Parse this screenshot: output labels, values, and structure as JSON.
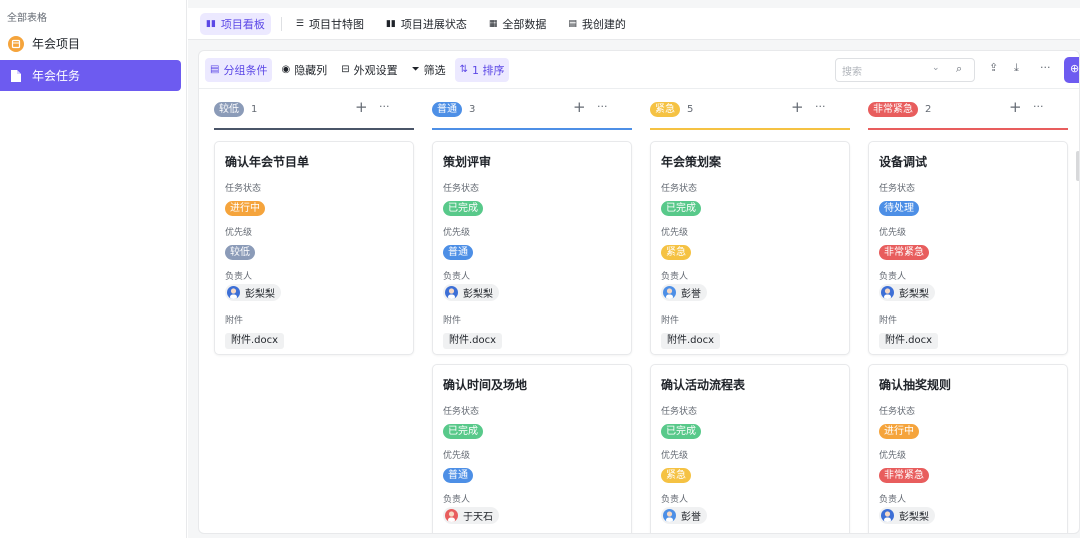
{
  "sidebar": {
    "title": "全部表格",
    "items": [
      {
        "label": "年会项目",
        "icon": "calendar-icon"
      },
      {
        "label": "年会任务",
        "icon": "document-icon"
      }
    ]
  },
  "tabs": [
    {
      "label": "项目看板",
      "icon": "kanban-icon"
    },
    {
      "label": "项目甘特图",
      "icon": "gantt-icon"
    },
    {
      "label": "项目进展状态",
      "icon": "kanban-icon"
    },
    {
      "label": "全部数据",
      "icon": "grid-icon"
    },
    {
      "label": "我创建的",
      "icon": "table-icon"
    }
  ],
  "toolbar": {
    "group_label": "分组条件",
    "hide_label": "隐藏列",
    "appearance_label": "外观设置",
    "filter_label": "筛选",
    "sort_label": "1 排序",
    "search_placeholder": "搜索"
  },
  "fields": {
    "status": "任务状态",
    "priority": "优先级",
    "owner": "负责人",
    "attachment": "附件"
  },
  "colors": {
    "accent": "#6d5bf0",
    "low": "#8b9bb8",
    "normal": "#4d8fe6",
    "urgent": "#f5c243",
    "very_urgent": "#e85d5d",
    "in_progress": "#f5a43c",
    "done": "#58c98a",
    "pending": "#4d8fe6"
  },
  "columns": [
    {
      "label": "较低",
      "count": "1",
      "cards": [
        {
          "title": "确认年会节目单",
          "status": "进行中",
          "priority": "较低",
          "owner": "彭梨梨",
          "attachment": "附件.docx"
        }
      ]
    },
    {
      "label": "普通",
      "count": "3",
      "cards": [
        {
          "title": "策划评审",
          "status": "已完成",
          "priority": "普通",
          "owner": "彭梨梨",
          "attachment": "附件.docx"
        },
        {
          "title": "确认时间及场地",
          "status": "已完成",
          "priority": "普通",
          "owner": "于天石"
        }
      ]
    },
    {
      "label": "紧急",
      "count": "5",
      "cards": [
        {
          "title": "年会策划案",
          "status": "已完成",
          "priority": "紧急",
          "owner": "彭誉",
          "attachment": "附件.docx"
        },
        {
          "title": "确认活动流程表",
          "status": "已完成",
          "priority": "紧急",
          "owner": "彭誉"
        }
      ]
    },
    {
      "label": "非常紧急",
      "count": "2",
      "cards": [
        {
          "title": "设备调试",
          "status": "待处理",
          "priority": "非常紧急",
          "owner": "彭梨梨",
          "attachment": "附件.docx"
        },
        {
          "title": "确认抽奖规则",
          "status": "进行中",
          "priority": "非常紧急",
          "owner": "彭梨梨"
        }
      ]
    }
  ]
}
